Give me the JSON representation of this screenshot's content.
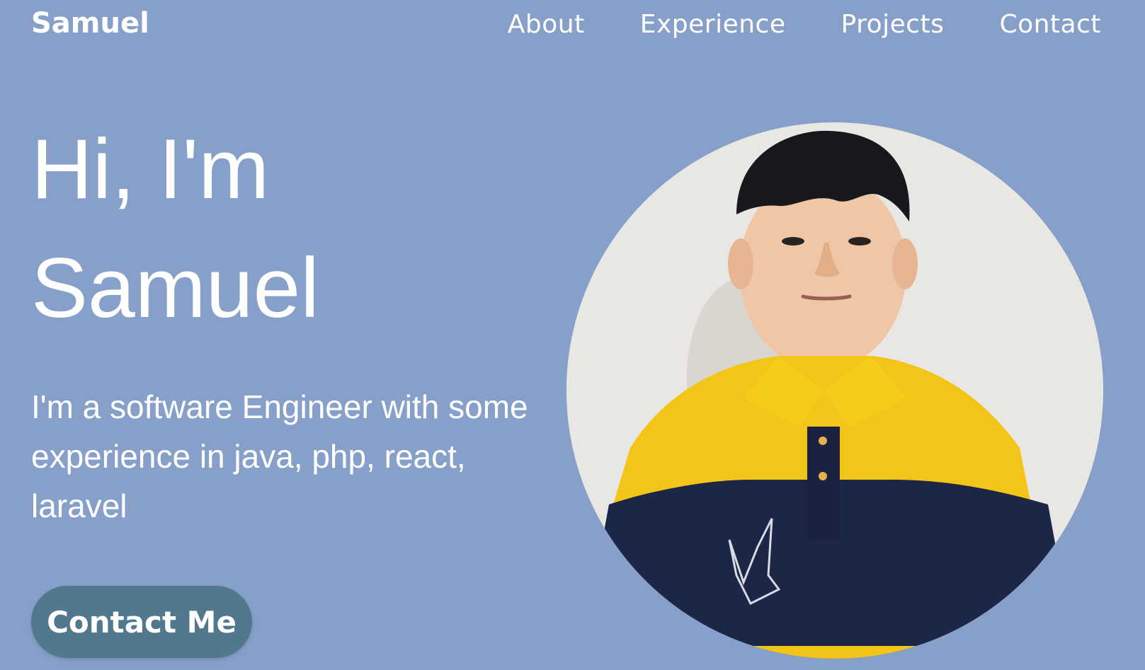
{
  "nav": {
    "brand": "Samuel",
    "links": [
      "About",
      "Experience",
      "Projects",
      "Contact"
    ]
  },
  "hero": {
    "greeting_line1": "Hi, I'm",
    "greeting_line2": "Samuel",
    "description": "I'm a software Engineer with some experience in java, php, react, laravel",
    "cta_label": "Contact Me"
  },
  "colors": {
    "background": "#87a0c9",
    "button": "#52788e",
    "text": "#ffffff"
  },
  "icons": {
    "profile_photo": "profile-photo"
  }
}
